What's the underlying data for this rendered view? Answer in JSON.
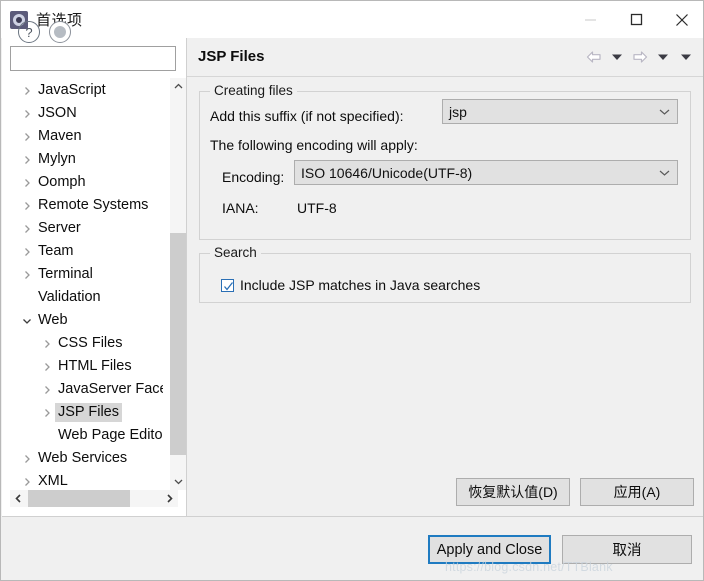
{
  "window": {
    "title": "首选项",
    "icon": "preferences-gear-icon",
    "minimize_label": "—",
    "maximize_label": "□",
    "close_label": "✕"
  },
  "sidebar": {
    "filter_value": "",
    "filter_placeholder": "",
    "items": [
      {
        "label": "JavaScript",
        "level": 0,
        "expandable": true,
        "expanded": false,
        "selected": false
      },
      {
        "label": "JSON",
        "level": 0,
        "expandable": true,
        "expanded": false,
        "selected": false
      },
      {
        "label": "Maven",
        "level": 0,
        "expandable": true,
        "expanded": false,
        "selected": false
      },
      {
        "label": "Mylyn",
        "level": 0,
        "expandable": true,
        "expanded": false,
        "selected": false
      },
      {
        "label": "Oomph",
        "level": 0,
        "expandable": true,
        "expanded": false,
        "selected": false
      },
      {
        "label": "Remote Systems",
        "level": 0,
        "expandable": true,
        "expanded": false,
        "selected": false
      },
      {
        "label": "Server",
        "level": 0,
        "expandable": true,
        "expanded": false,
        "selected": false
      },
      {
        "label": "Team",
        "level": 0,
        "expandable": true,
        "expanded": false,
        "selected": false
      },
      {
        "label": "Terminal",
        "level": 0,
        "expandable": true,
        "expanded": false,
        "selected": false
      },
      {
        "label": "Validation",
        "level": 0,
        "expandable": false,
        "expanded": false,
        "selected": false
      },
      {
        "label": "Web",
        "level": 0,
        "expandable": true,
        "expanded": true,
        "selected": false
      },
      {
        "label": "CSS Files",
        "level": 1,
        "expandable": true,
        "expanded": false,
        "selected": false
      },
      {
        "label": "HTML Files",
        "level": 1,
        "expandable": true,
        "expanded": false,
        "selected": false
      },
      {
        "label": "JavaServer Faces Tools",
        "level": 1,
        "expandable": true,
        "expanded": false,
        "selected": false
      },
      {
        "label": "JSP Files",
        "level": 1,
        "expandable": true,
        "expanded": false,
        "selected": true
      },
      {
        "label": "Web Page Editor",
        "level": 1,
        "expandable": false,
        "expanded": false,
        "selected": false
      },
      {
        "label": "Web Services",
        "level": 0,
        "expandable": true,
        "expanded": false,
        "selected": false
      },
      {
        "label": "XML",
        "level": 0,
        "expandable": true,
        "expanded": false,
        "selected": false
      }
    ]
  },
  "page": {
    "title": "JSP Files",
    "nav": {
      "back_icon": "arrow-left-icon",
      "back_menu_icon": "chevron-down-icon",
      "forward_icon": "arrow-right-icon",
      "forward_menu_icon": "chevron-down-icon",
      "view_menu_icon": "chevron-down-icon"
    },
    "creating_files": {
      "group_label": "Creating files",
      "suffix_label": "Add this suffix (if not specified):",
      "suffix_value": "jsp",
      "encoding_note": "The following encoding will apply:",
      "encoding_label": "Encoding:",
      "encoding_value": "ISO 10646/Unicode(UTF-8)",
      "iana_label": "IANA:",
      "iana_value": "UTF-8"
    },
    "search": {
      "group_label": "Search",
      "checkbox_label": "Include JSP matches in Java searches",
      "checkbox_checked": true
    },
    "restore_defaults_label": "恢复默认值(D)",
    "apply_label": "应用(A)"
  },
  "footer": {
    "help_icon": "question-mark-icon",
    "navigation_icon": "circle-dot-icon",
    "apply_and_close_label": "Apply and Close",
    "cancel_label": "取消",
    "watermark": "https://blog.csdn.net/TTBlank"
  },
  "colors": {
    "accent": "#1f7bc1",
    "panel_bg": "#f0f0f0",
    "control_bg": "#e1e1e1",
    "selection_bg": "#d6d6d6"
  }
}
